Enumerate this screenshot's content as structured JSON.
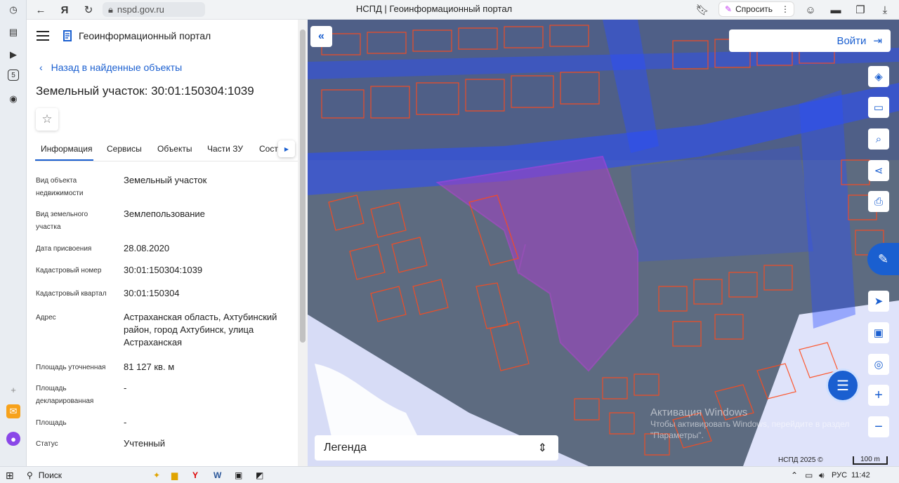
{
  "browser": {
    "url": "nspd.gov.ru",
    "page_title": "НСПД | Геоинформационный портал",
    "ask_button": "Спросить",
    "rail_badge": "5"
  },
  "panel": {
    "portal_title": "Геоинформационный портал",
    "back_label": "Назад в найденные объекты",
    "object_title": "Земельный участок: 30:01:150304:1039",
    "tabs": [
      "Информация",
      "Сервисы",
      "Объекты",
      "Части ЗУ",
      "Соста"
    ],
    "properties": [
      {
        "label": "Вид объекта недвижимости",
        "value": "Земельный участок"
      },
      {
        "label": "Вид земельного участка",
        "value": "Землепользование"
      },
      {
        "label": "Дата присвоения",
        "value": "28.08.2020"
      },
      {
        "label": "Кадастровый номер",
        "value": "30:01:150304:1039"
      },
      {
        "label": "Кадастровый квартал",
        "value": "30:01:150304"
      },
      {
        "label": "Адрес",
        "value": "Астраханская область, Ахтубинский район, город Ахтубинск, улица Астраханская"
      },
      {
        "label": "Площадь уточненная",
        "value": "81 127 кв. м"
      },
      {
        "label": "Площадь декларированная",
        "value": "-"
      },
      {
        "label": "Площадь",
        "value": "-"
      },
      {
        "label": "Статус",
        "value": "Учтенный"
      }
    ]
  },
  "map": {
    "login_label": "Войти",
    "legend_label": "Легенда",
    "copyright": "НСПД 2025 ©",
    "scale_label": "100 m",
    "watermark_title": "Активация Windows",
    "watermark_text": "Чтобы активировать Windows, перейдите в раздел \"Параметры\"."
  },
  "taskbar": {
    "search_label": "Поиск",
    "language": "РУС",
    "time": "11:42"
  },
  "colors": {
    "accent": "#1a5fd0",
    "parcel_outline": "#ff4a1c",
    "zone_fill": "#2a4dff",
    "selected_parcel": "#b13ad6"
  }
}
